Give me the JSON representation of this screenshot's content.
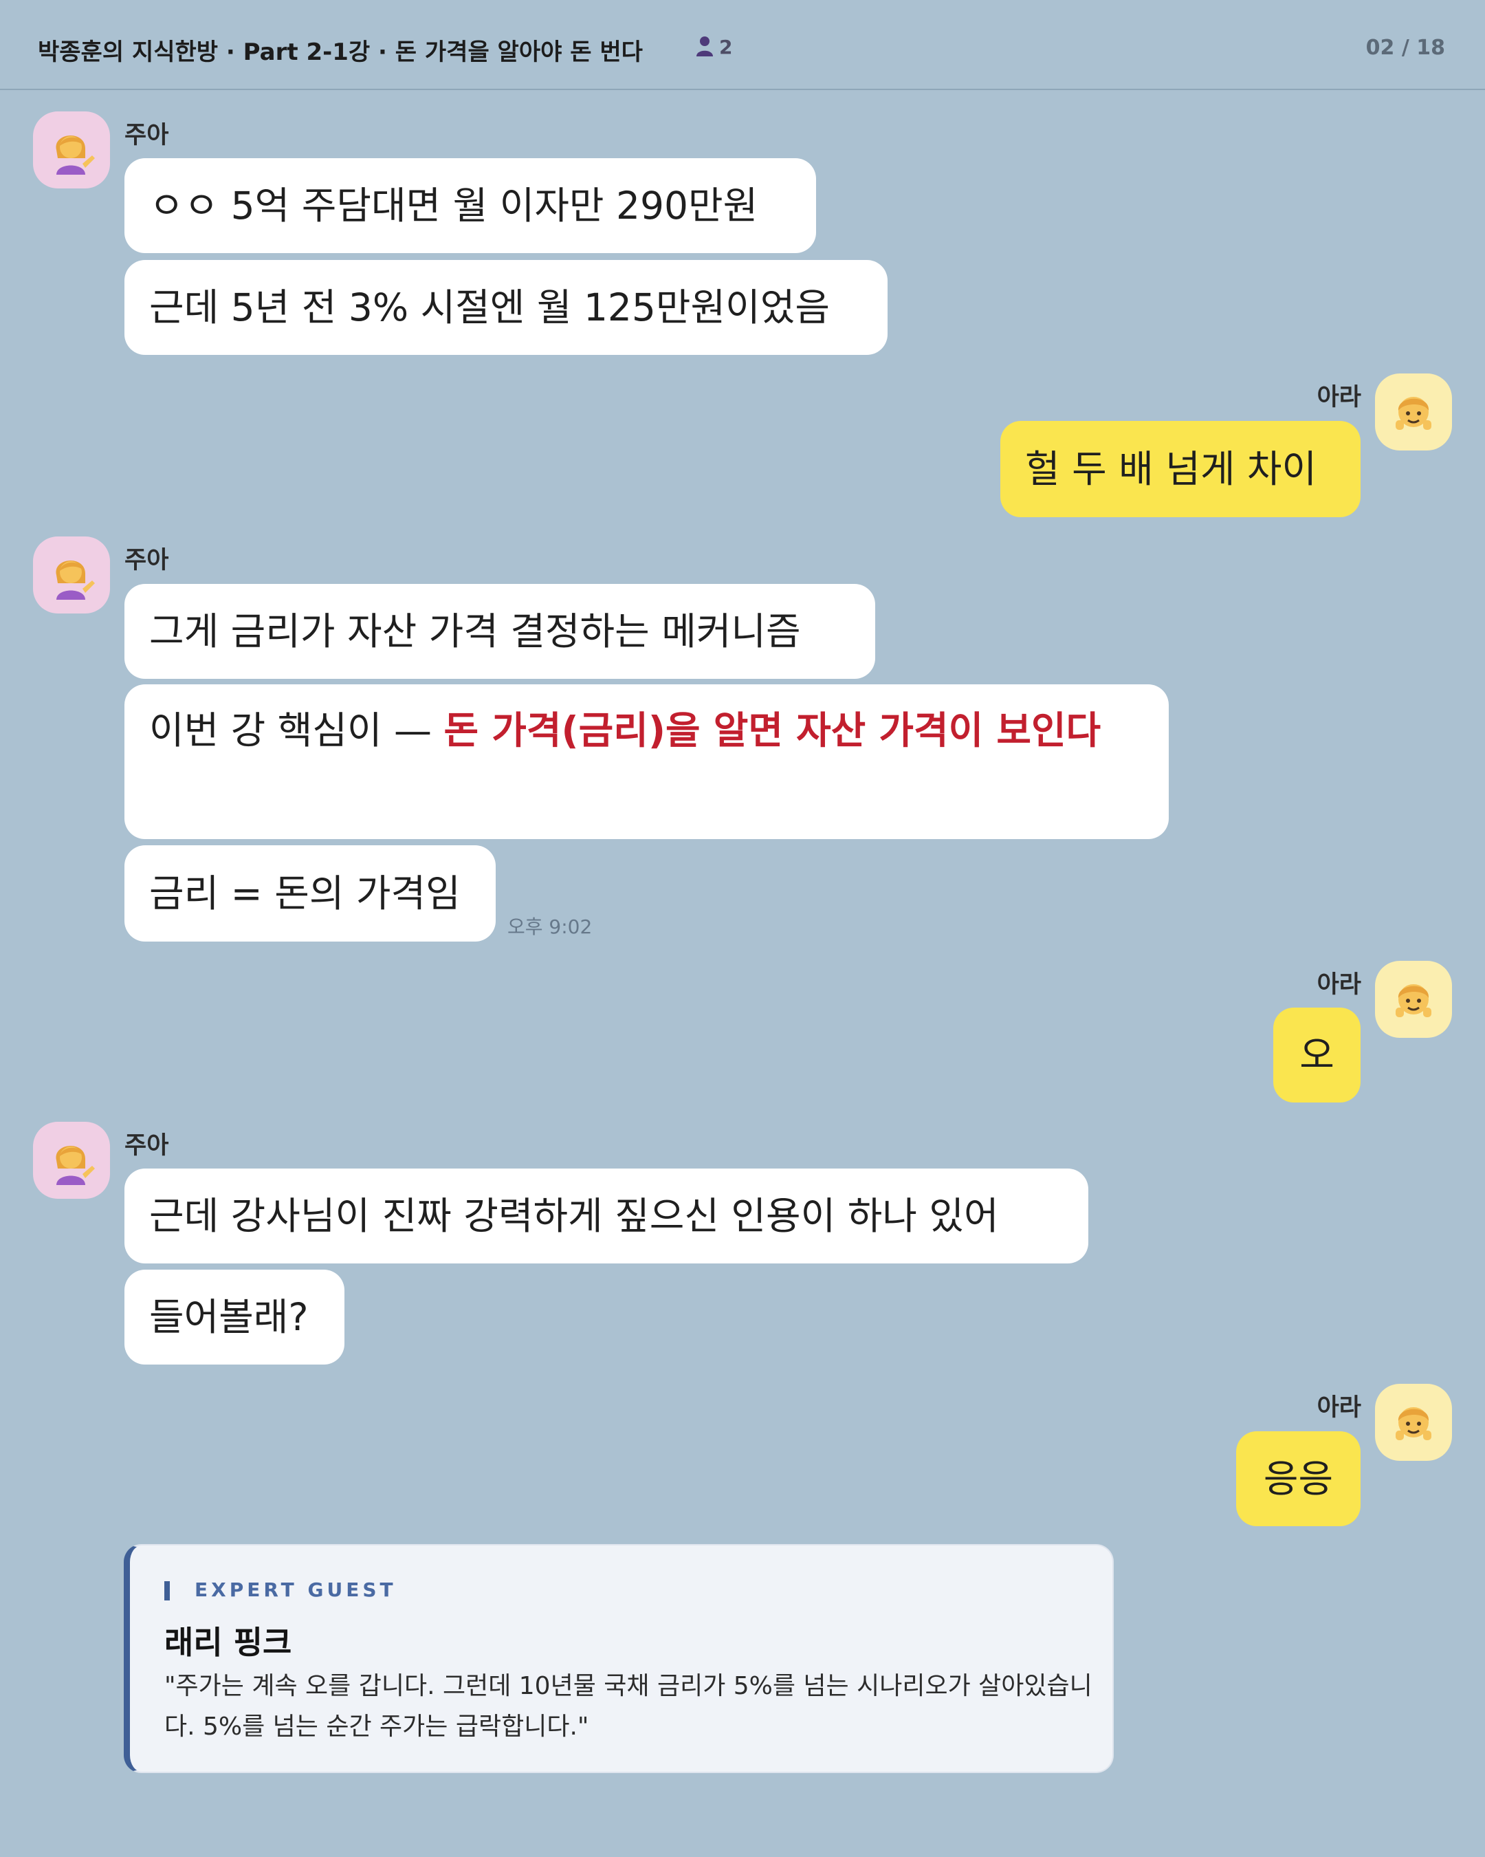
{
  "header": {
    "title": "박종훈의 지식한방 · Part 2-1강 · 돈 가격을 알아야 돈 번다",
    "member_count": "2",
    "page_counter": "02 / 18"
  },
  "participants": {
    "left_name": "주아",
    "right_name": "아라",
    "left_avatar_icon": "person-tipping-hand-emoji",
    "right_avatar_icon": "child-emoji"
  },
  "messages": {
    "g1": {
      "sender": "주아",
      "m1": "ㅇㅇ 5억 주담대면 월 이자만 290만원",
      "m2": "근데 5년 전 3% 시절엔 월 125만원이었음"
    },
    "r1": {
      "sender": "아라",
      "m1": "헐 두 배 넘게 차이"
    },
    "g2": {
      "sender": "주아",
      "m1": "그게 금리가 자산 가격 결정하는 메커니즘",
      "m2_prefix": "이번 강 핵심이 — ",
      "m2_emph": "돈 가격(금리)을 알면 자산 가격이 보인다",
      "m3": "금리 = 돈의 가격임",
      "time": "오후 9:02"
    },
    "r2": {
      "sender": "아라",
      "m1": "오"
    },
    "g3": {
      "sender": "주아",
      "m1": "근데 강사님이 진짜 강력하게 짚으신 인용이 하나 있어",
      "m2": "들어볼래?"
    },
    "r3": {
      "sender": "아라",
      "m1": "응응"
    }
  },
  "quote": {
    "tag": "EXPERT GUEST",
    "name": "래리 핑크",
    "text": "\"주가는 계속 오를 갑니다. 그런데 10년물 국채 금리가 5%를 넘는 시나리오가 살아있습니다. 5%를 넘는 순간 주가는 급락합니다.\""
  },
  "colors": {
    "background": "#abc1d1",
    "my_bubble": "#fae54f",
    "other_bubble": "#ffffff",
    "emphasis": "#c21f2e",
    "quote_accent": "#3f5f96"
  }
}
